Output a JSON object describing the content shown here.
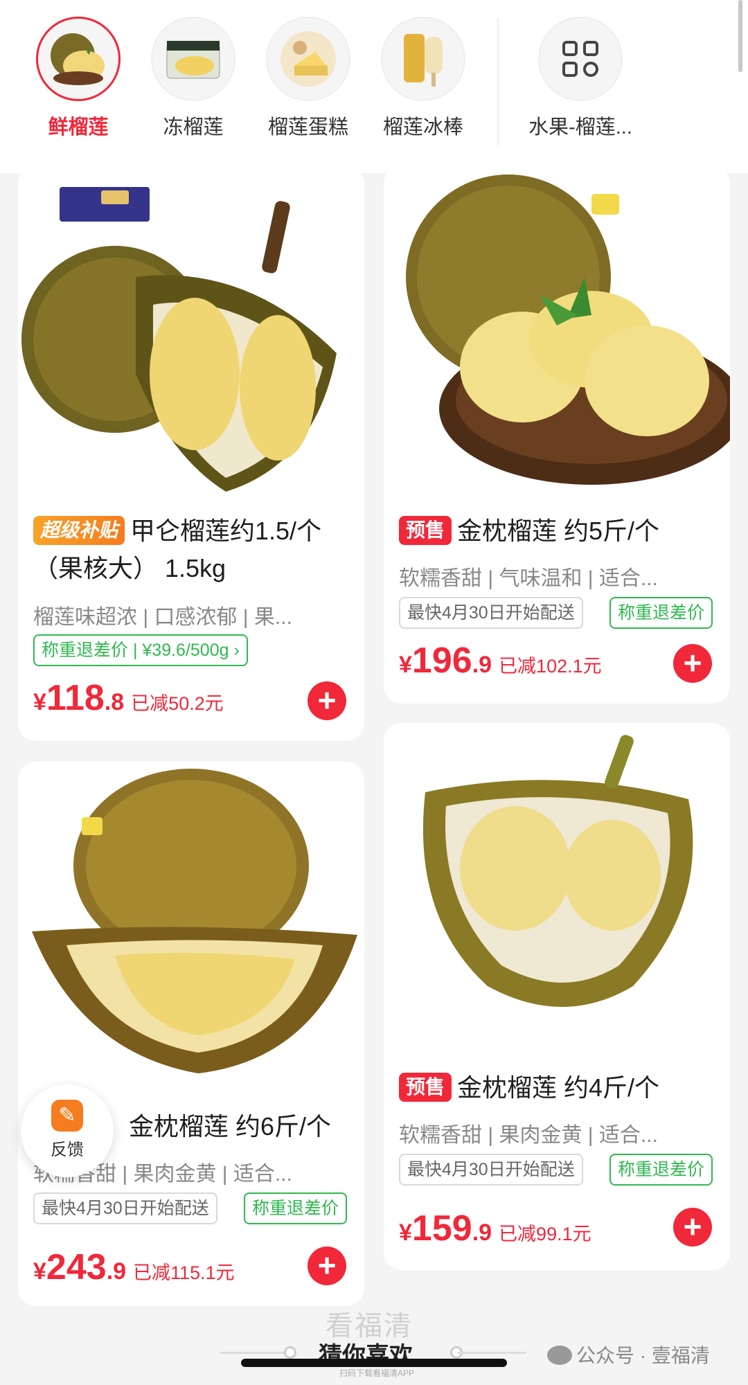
{
  "categories": [
    {
      "label": "鲜榴莲",
      "active": true
    },
    {
      "label": "冻榴莲",
      "active": false
    },
    {
      "label": "榴莲蛋糕",
      "active": false
    },
    {
      "label": "榴莲冰棒",
      "active": false
    },
    {
      "label": "水果-榴莲...",
      "active": false
    }
  ],
  "products": [
    {
      "tag": "超级补贴",
      "title": "甲仑榴莲约1.5/个（果核大） 1.5kg",
      "subtitle": "榴莲味超浓 | 口感浓郁 | 果...",
      "pill": "称重退差价 | ¥39.6/500g ›",
      "price_symbol": "¥",
      "price_int": "118",
      "price_dec": ".8",
      "discount": "已减50.2元"
    },
    {
      "tag": "预售",
      "title": "金枕榴莲 约5斤/个",
      "subtitle": "软糯香甜 | 气味温和 | 适合...",
      "delivery": "最快4月30日开始配送",
      "weight_pill": "称重退差价",
      "price_symbol": "¥",
      "price_int": "196",
      "price_dec": ".9",
      "discount": "已减102.1元"
    },
    {
      "title": "金枕榴莲 约6斤/个",
      "subtitle": "软糯香甜 | 果肉金黄 | 适合...",
      "delivery": "最快4月30日开始配送",
      "weight_pill": "称重退差价",
      "price_symbol": "¥",
      "price_int": "243",
      "price_dec": ".9",
      "discount": "已减115.1元"
    },
    {
      "tag": "预售",
      "title": "金枕榴莲 约4斤/个",
      "subtitle": "软糯香甜 | 果肉金黄 | 适合...",
      "delivery": "最快4月30日开始配送",
      "weight_pill": "称重退差价",
      "price_symbol": "¥",
      "price_int": "159",
      "price_dec": ".9",
      "discount": "已减99.1元"
    }
  ],
  "feedback_label": "反馈",
  "guess_title": "猜你喜欢",
  "watermark": "看福清",
  "watermark_small": "扫码下载看福清APP",
  "wechat_source": "公众号 · 壹福清",
  "colors": {
    "accent": "#f0283a",
    "green": "#2fb84f",
    "orange": "#f57c1f"
  }
}
